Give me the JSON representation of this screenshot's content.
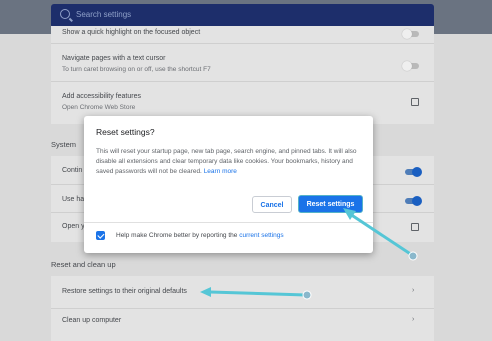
{
  "search": {
    "placeholder": "Search settings"
  },
  "accessibility": {
    "highlight_label": "Show a quick highlight on the focused object",
    "caret_title": "Navigate pages with a text cursor",
    "caret_sub": "To turn caret browsing on or off, use the shortcut F7",
    "features_title": "Add accessibility features",
    "features_sub": "Open Chrome Web Store"
  },
  "system": {
    "heading": "System",
    "row1": "Contin",
    "row2": "Use ha",
    "row3": "Open y"
  },
  "reset_section": {
    "heading": "Reset and clean up",
    "restore": "Restore settings to their original defaults",
    "cleanup": "Clean up computer"
  },
  "dialog": {
    "title": "Reset settings?",
    "body_text": "This will reset your startup page, new tab page, search engine, and pinned tabs. It will also disable all extensions and clear temporary data like cookies. Your bookmarks, history and saved passwords will not be cleared.",
    "learn_more": "Learn more",
    "cancel_label": "Cancel",
    "reset_label": "Reset settings",
    "checkbox_text": "Help make Chrome better by reporting the",
    "checkbox_link": "current settings"
  },
  "colors": {
    "accent": "#1a73e8",
    "annotation": "#55c6d6"
  }
}
